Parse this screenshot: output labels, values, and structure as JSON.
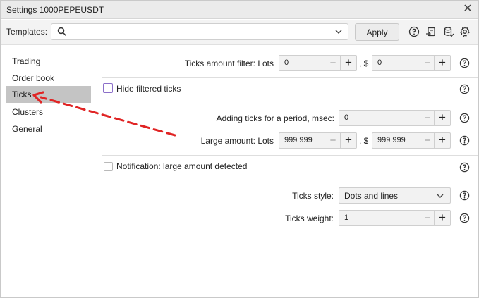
{
  "window": {
    "title": "Settings 1000PEPEUSDT"
  },
  "templates": {
    "label": "Templates:",
    "value": "",
    "apply_label": "Apply",
    "icons": [
      "help-icon",
      "export-icon",
      "database-icon",
      "gear-icon"
    ]
  },
  "sidebar": {
    "items": [
      {
        "label": "Trading",
        "active": false
      },
      {
        "label": "Order book",
        "active": false
      },
      {
        "label": "Ticks",
        "active": true
      },
      {
        "label": "Clusters",
        "active": false
      },
      {
        "label": "General",
        "active": false
      }
    ]
  },
  "settings": {
    "ticks_filter": {
      "label": "Ticks amount filter: Lots",
      "lots_value": "0",
      "separator": ", $",
      "usd_value": "0"
    },
    "hide_filtered": {
      "label": "Hide filtered ticks",
      "checked": false
    },
    "adding_ticks": {
      "label": "Adding ticks for a period, msec:",
      "value": "0"
    },
    "large_amount": {
      "label": "Large amount: Lots",
      "lots_value": "999 999",
      "separator": ", $",
      "usd_value": "999 999"
    },
    "notification": {
      "label": "Notification: large amount detected",
      "checked": false
    },
    "ticks_style": {
      "label": "Ticks style:",
      "value": "Dots and lines"
    },
    "ticks_weight": {
      "label": "Ticks weight:",
      "value": "1"
    }
  },
  "colors": {
    "annotation_arrow": "#e02424",
    "active_nav": "#c4c4c4",
    "checkbox_highlight": "#8c6fc9"
  }
}
